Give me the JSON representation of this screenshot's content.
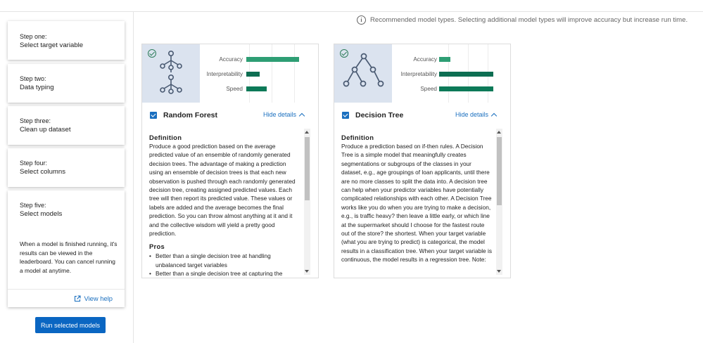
{
  "sidebar": {
    "steps": [
      {
        "num": "Step one:",
        "title": "Select target variable"
      },
      {
        "num": "Step two:",
        "title": "Data typing"
      },
      {
        "num": "Step three:",
        "title": "Clean up dataset"
      },
      {
        "num": "Step four:",
        "title": "Select columns"
      },
      {
        "num": "Step five:",
        "title": "Select models"
      }
    ],
    "step5_description": "When a model is finished running, it's results can be viewed in the leaderboard. You can cancel running a model at anytime.",
    "view_help_label": "View help",
    "run_button_label": "Run selected models"
  },
  "banner": {
    "icon": "info-icon",
    "text": "Recommended model types. Selecting additional model types will improve accuracy but increase run time."
  },
  "models": [
    {
      "name": "Random Forest",
      "checked": true,
      "recommended": true,
      "icon": "random-forest-icon",
      "hide_details_label": "Hide details",
      "metrics": [
        {
          "label": "Accuracy",
          "value": 0.85,
          "color": "#2e9e74"
        },
        {
          "label": "Interpretability",
          "value": 0.22,
          "color": "#0d6e52"
        },
        {
          "label": "Speed",
          "value": 0.33,
          "color": "#0d7a58"
        }
      ],
      "definition_heading": "Definition",
      "definition": "Produce a good prediction based on the average predicted value of an ensemble of randomly generated decision trees. The advantage of making a prediction using an ensemble of decision trees is that each new observation is pushed through each randomly generated decision tree, creating assigned predicted values. Each tree will then report its predicted value. These values or labels are added and the average becomes the final prediction. So you can throw almost anything at it and it and the collective wisdom will yield a pretty good prediction.",
      "pros_heading": "Pros",
      "pros": [
        "Better than a single decision tree at handling unbalanced target variables",
        "Better than a single decision tree at capturing the"
      ]
    },
    {
      "name": "Decision Tree",
      "checked": true,
      "recommended": true,
      "icon": "decision-tree-icon",
      "hide_details_label": "Hide details",
      "metrics": [
        {
          "label": "Accuracy",
          "value": 0.18,
          "color": "#2e9e74"
        },
        {
          "label": "Interpretability",
          "value": 0.88,
          "color": "#0d6e52"
        },
        {
          "label": "Speed",
          "value": 0.88,
          "color": "#0d7a58"
        }
      ],
      "definition_heading": "Definition",
      "definition": "Produce a prediction based on if-then rules. A Decision Tree is a simple model that meaningfully creates segmentations or subgroups of the classes in your dataset, e.g., age groupings of loan applicants, until there are no more classes to split the data into. A decision tree can help when your predictor variables have potentially complicated relationships with each other. A Decision Tree works like you do when you are trying to make a decision, e.g., is traffic heavy? then leave a little early, or which line at the supermarket should I choose for the fastest route out of the store? the shortest. When your target variable (what you are trying to predict) is categorical, the model results in a classification tree. When your target variable is continuous, the model results in a regression tree. Note:",
      "pros_heading": "",
      "pros": []
    }
  ]
}
